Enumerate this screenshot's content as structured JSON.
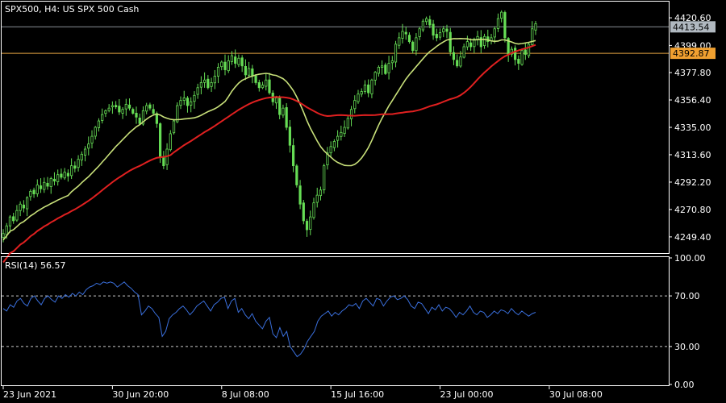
{
  "chart_data": [
    {
      "type": "candlestick",
      "title": "SPX500, H4:  US SPX 500 Cash",
      "symbol": "SPX500",
      "timeframe": "H4",
      "instrument": "US SPX 500 Cash",
      "y_ticks": [
        "4420.60",
        "4399.00",
        "4377.80",
        "4356.40",
        "4335.00",
        "4313.60",
        "4292.20",
        "4270.80",
        "4249.40"
      ],
      "ylim": [
        4238,
        4432
      ],
      "price_tags": [
        {
          "value": "4413.54",
          "color": "#b0b8c0",
          "text_color": "#000000",
          "line_color": "#8a9096"
        },
        {
          "value": "4392.87",
          "color": "#f0a030",
          "text_color": "#000000",
          "line_color": "#e0a040"
        }
      ],
      "x_tick_labels": [
        "23 Jun 2021",
        "30 Jun 20:00",
        "8 Jul 08:00",
        "15 Jul 16:00",
        "23 Jul 00:00",
        "30 Jul 08:00"
      ],
      "x_tick_bar_index": [
        0,
        32,
        64,
        96,
        128,
        160
      ],
      "close_series": [
        4252,
        4258,
        4265,
        4262,
        4270,
        4275,
        4272,
        4280,
        4285,
        4283,
        4290,
        4287,
        4292,
        4289,
        4295,
        4293,
        4298,
        4296,
        4300,
        4297,
        4305,
        4303,
        4310,
        4314,
        4318,
        4322,
        4328,
        4335,
        4340,
        4345,
        4348,
        4350,
        4352,
        4351,
        4347,
        4349,
        4353,
        4350,
        4346,
        4343,
        4338,
        4348,
        4352,
        4350,
        4346,
        4338,
        4312,
        4305,
        4318,
        4330,
        4340,
        4352,
        4356,
        4358,
        4352,
        4355,
        4360,
        4366,
        4370,
        4372,
        4366,
        4370,
        4375,
        4382,
        4386,
        4380,
        4387,
        4391,
        4385,
        4389,
        4383,
        4376,
        4381,
        4375,
        4370,
        4366,
        4368,
        4372,
        4362,
        4355,
        4358,
        4345,
        4350,
        4335,
        4321,
        4305,
        4290,
        4275,
        4262,
        4255,
        4265,
        4276,
        4282,
        4286,
        4305,
        4315,
        4320,
        4324,
        4328,
        4331,
        4335,
        4342,
        4349,
        4356,
        4361,
        4363,
        4368,
        4362,
        4372,
        4378,
        4382,
        4383,
        4377,
        4385,
        4387,
        4400,
        4405,
        4410,
        4408,
        4402,
        4395,
        4405,
        4412,
        4418,
        4420,
        4415,
        4407,
        4405,
        4409,
        4412,
        4410,
        4394,
        4388,
        4383,
        4390,
        4398,
        4402,
        4398,
        4404,
        4406,
        4398,
        4406,
        4402,
        4405,
        4412,
        4420,
        4425,
        4405,
        4392,
        4396,
        4388,
        4385,
        4395,
        4392,
        4400,
        4412,
        4416
      ],
      "series": [
        {
          "name": "",
          "kind": "ma",
          "color": "#c8e07a",
          "period": 20
        },
        {
          "name": "",
          "kind": "ma",
          "color": "#e02020",
          "period": 50
        }
      ],
      "candle_color": "#66dd55"
    },
    {
      "type": "line",
      "title": "RSI(14) 56.57",
      "indicator": "RSI",
      "period": 14,
      "current_value": "56.57",
      "y_ticks": [
        "100.00",
        "70.00",
        "30.00",
        "0.00"
      ],
      "ylim": [
        0,
        100
      ],
      "levels": [
        70,
        30
      ],
      "series": [
        {
          "name": "",
          "color": "#3a6fdc",
          "values": [
            60,
            58,
            63,
            61,
            66,
            68,
            64,
            62,
            68,
            70,
            66,
            63,
            68,
            70,
            67,
            65,
            70,
            68,
            71,
            69,
            72,
            70,
            73,
            71,
            75,
            77,
            78,
            80,
            79,
            81,
            80,
            81,
            80,
            77,
            79,
            81,
            78,
            76,
            73,
            71,
            55,
            58,
            62,
            60,
            56,
            53,
            38,
            42,
            52,
            55,
            57,
            60,
            62,
            59,
            55,
            58,
            62,
            64,
            66,
            62,
            58,
            63,
            65,
            68,
            69,
            60,
            66,
            68,
            57,
            60,
            55,
            52,
            56,
            50,
            47,
            44,
            50,
            53,
            40,
            37,
            45,
            38,
            42,
            30,
            26,
            22,
            24,
            28,
            34,
            38,
            42,
            50,
            54,
            56,
            58,
            54,
            57,
            55,
            58,
            60,
            63,
            62,
            64,
            60,
            66,
            68,
            65,
            62,
            68,
            67,
            62,
            66,
            69,
            70,
            67,
            68,
            70,
            67,
            62,
            60,
            65,
            64,
            60,
            56,
            61,
            59,
            63,
            58,
            61,
            60,
            57,
            53,
            57,
            55,
            58,
            62,
            57,
            55,
            58,
            57,
            53,
            55,
            58,
            56,
            59,
            58,
            56,
            60,
            57,
            55,
            58,
            56,
            54,
            56,
            57
          ]
        }
      ]
    }
  ]
}
